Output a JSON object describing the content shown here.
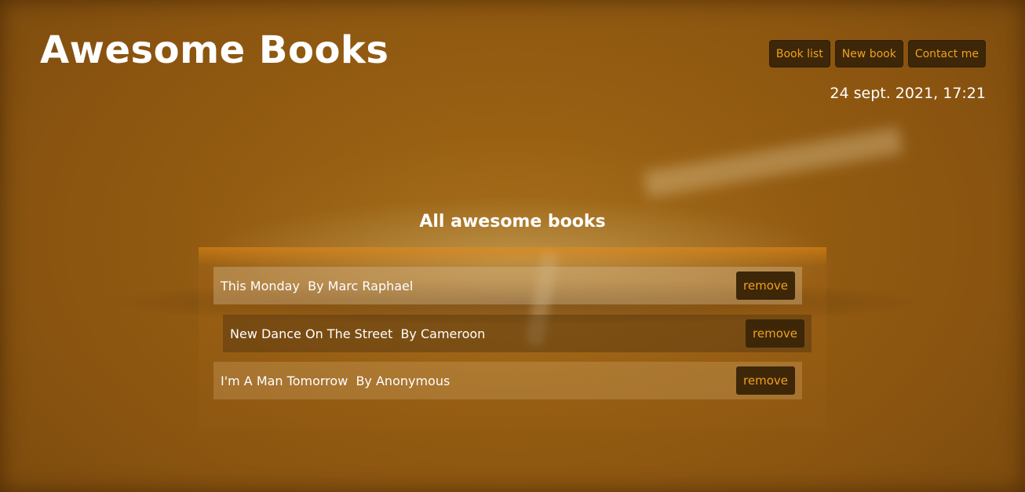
{
  "header": {
    "title": "Awesome Books",
    "date": "24 sept. 2021, 17:21"
  },
  "nav": {
    "items": [
      {
        "label": "Book list"
      },
      {
        "label": "New book"
      },
      {
        "label": "Contact me"
      }
    ]
  },
  "main": {
    "section_title": "All awesome books",
    "remove_label": "remove",
    "books": [
      {
        "title": "This Monday",
        "author": "By Marc Raphael"
      },
      {
        "title": "New Dance On The Street",
        "author": "By Cameroon"
      },
      {
        "title": "I'm A Man Tomorrow",
        "author": "By Anonymous"
      }
    ]
  },
  "colors": {
    "button_bg": "#3d2708",
    "button_text": "#f0a020",
    "background": "#8a5410"
  }
}
